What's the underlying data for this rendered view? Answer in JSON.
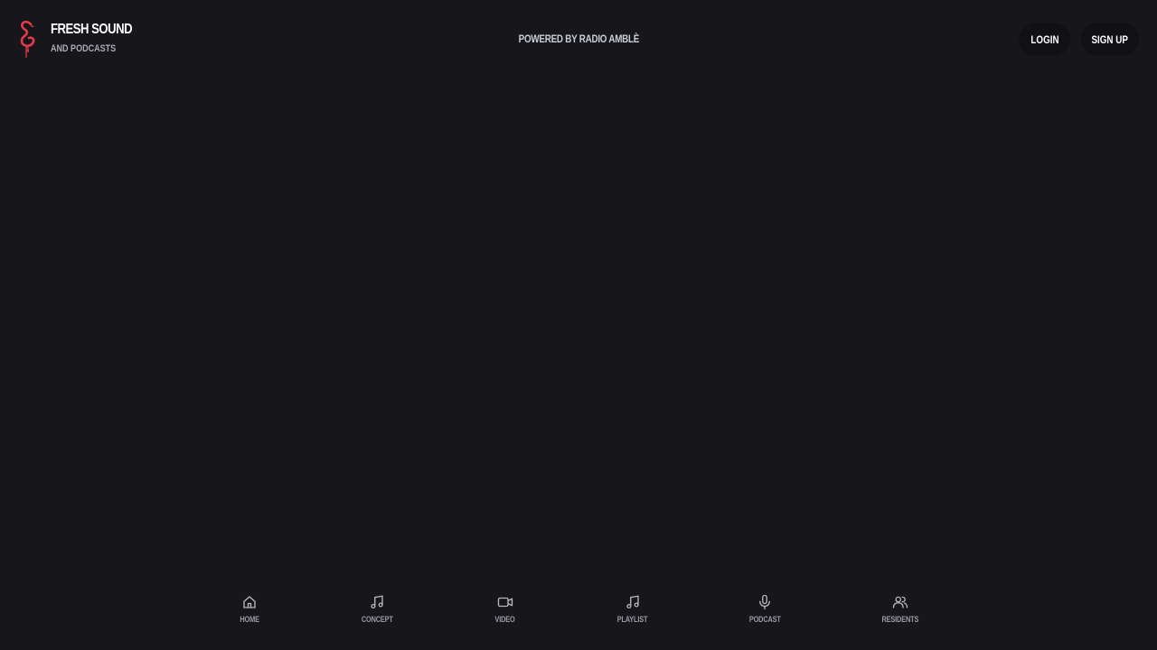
{
  "brand": {
    "title": "FRESH SOUND",
    "subtitle": "AND PODCASTS",
    "logo_icon": "flamingo-icon",
    "logo_color": "#e23a4a"
  },
  "header": {
    "powered_by": "POWERED BY RADIO AMBLÈ",
    "login_label": "LOGIN",
    "signup_label": "SIGN UP"
  },
  "bottom_nav": {
    "items": [
      {
        "label": "HOME",
        "icon": "home-icon"
      },
      {
        "label": "CONCEPT",
        "icon": "music-note-icon"
      },
      {
        "label": "VIDEO",
        "icon": "video-camera-icon"
      },
      {
        "label": "PLAYLIST",
        "icon": "music-note-icon"
      },
      {
        "label": "PODCAST",
        "icon": "microphone-icon"
      },
      {
        "label": "RESIDENTS",
        "icon": "users-icon"
      }
    ]
  },
  "colors": {
    "background": "#17161b",
    "button_bg": "#111015",
    "nav_text": "#9a9aa3",
    "nav_icon": "#b7b7bf"
  }
}
